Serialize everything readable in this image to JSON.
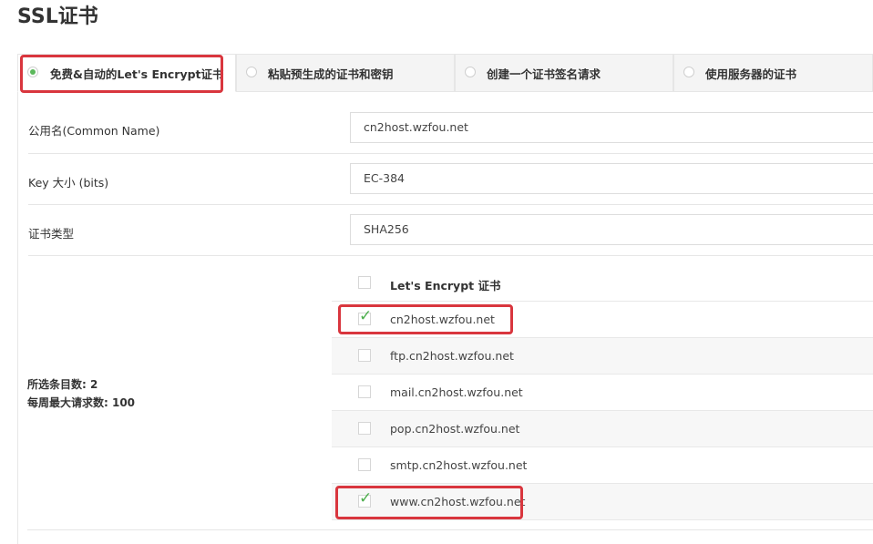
{
  "page_title": "SSL证书",
  "tabs": [
    {
      "label": "免费&自动的Let's Encrypt证书",
      "selected": true
    },
    {
      "label": "粘贴预生成的证书和密钥",
      "selected": false
    },
    {
      "label": "创建一个证书签名请求",
      "selected": false
    },
    {
      "label": "使用服务器的证书",
      "selected": false
    }
  ],
  "form": {
    "common_name": {
      "label": "公用名(Common Name)",
      "value": "cn2host.wzfou.net"
    },
    "key_size": {
      "label": "Key 大小 (bits)",
      "value": "EC-384"
    },
    "cert_type": {
      "label": "证书类型",
      "value": "SHA256"
    }
  },
  "cert_list": {
    "header": "Let's Encrypt 证书",
    "items": [
      {
        "domain": "cn2host.wzfou.net",
        "checked": true
      },
      {
        "domain": "ftp.cn2host.wzfou.net",
        "checked": false
      },
      {
        "domain": "mail.cn2host.wzfou.net",
        "checked": false
      },
      {
        "domain": "pop.cn2host.wzfou.net",
        "checked": false
      },
      {
        "domain": "smtp.cn2host.wzfou.net",
        "checked": false
      },
      {
        "domain": "www.cn2host.wzfou.net",
        "checked": true
      }
    ]
  },
  "summary": {
    "selected_count": "所选条目数: 2",
    "weekly_limit": "每周最大请求数: 100"
  },
  "colors": {
    "highlight": "#d9363e",
    "check": "#4cae4c",
    "radio_selected": "#5cb85c"
  }
}
